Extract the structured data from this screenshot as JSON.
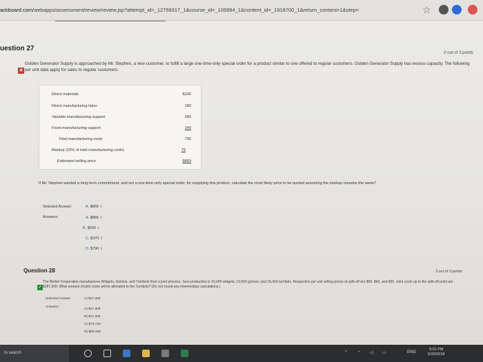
{
  "browser": {
    "url_host": "ackboard.com",
    "url_path": "/webapps/assessment/review/review.jsp?attempt_id=_12759317_1&course_id=_105994_1&content_id=_1918700_1&return_content=1&step="
  },
  "question27": {
    "title": "uestion 27",
    "points": "0 out of 3 points",
    "text": "Golden Generator Supply is approached by Mr. Stephen, a new customer, to fulfill a large one-time-only special order for a product similar to one offered to regular customers. Golden Generator Supply has excess capacity. The following per unit data apply for sales to regular customers:",
    "table": [
      {
        "label": "Direct materials",
        "value": "$190",
        "indent": false,
        "underline": false
      },
      {
        "label": "Direct manufacturing labor",
        "value": "180",
        "indent": false,
        "underline": false
      },
      {
        "label": "Variable manufacturing support",
        "value": "280",
        "indent": false,
        "underline": false
      },
      {
        "label": "Fixed manufacturing support",
        "value": "140",
        "indent": false,
        "underline": true
      },
      {
        "label": "Total manufacturing costs",
        "value": "790",
        "indent": true,
        "underline": false
      },
      {
        "label": "Markup (10% of total manufacturing costs)",
        "value": "79",
        "indent": false,
        "underline": true
      },
      {
        "label": "Estimated selling price",
        "value": "$869",
        "indent": true,
        "underline": true
      }
    ],
    "followup": "If Mr. Stephen wanted a long-term commitment, and not a one-time-only special order, for supplying this product, calculate the most likely price to be quoted assuming the markup remains the same?",
    "selected_label": "Selected Answer:",
    "answers_label": "Answers:",
    "selected_answer": {
      "letter": "A.",
      "value": "$869"
    },
    "options": [
      {
        "letter": "A.",
        "value": "$869"
      },
      {
        "letter": "B.",
        "value": "$650"
      },
      {
        "letter": "C.",
        "value": "$370"
      },
      {
        "letter": "D.",
        "value": "$790"
      }
    ]
  },
  "question28": {
    "title": "Question 28",
    "points": "3 out of 3 points",
    "text": "The Berkel Corporation manufactures Widgets, Gizmos, and Turnbols from a joint process. June production is 10,000 widgets; 13,500 gizmos; and 15,000 turnbols. Respective per unit selling prices at split-off are $95, $60, and $20. Joint costs up to the split-off point are $187,500. What amount of joint costs will be allocated to the Turnbols? (Do not round any intermediary calculations.)",
    "selected_label": "Selected Answer:",
    "answers_label": "Answers:",
    "selected_answer": "A) $27,306",
    "options": [
      "A) $27,306",
      "B) $17,000",
      "C) $73,726",
      "D) $86,468"
    ]
  },
  "taskbar": {
    "search_text": "to search",
    "clock_time": "9:01 PM",
    "clock_date": "5/30/2018",
    "tray_lang": "ENG"
  },
  "colors": {
    "incorrect": "#c0392b",
    "correct": "#2e8b3a",
    "taskbar": "#2c2d2f"
  }
}
